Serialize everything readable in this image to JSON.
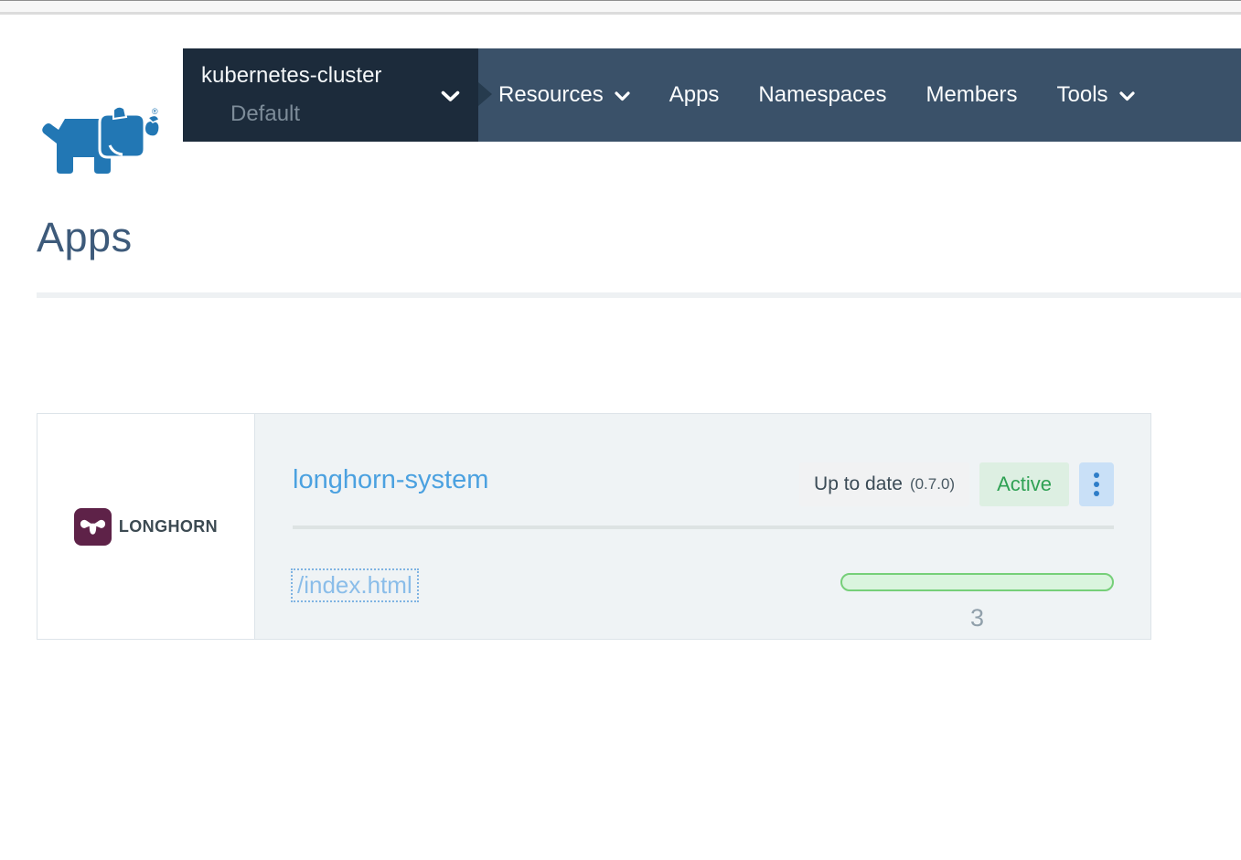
{
  "nav": {
    "logo": {
      "name": "Rancher",
      "registered_mark": "®"
    },
    "cluster": {
      "name": "kubernetes-cluster",
      "project": "Default"
    },
    "items": [
      {
        "label": "Resources",
        "dropdown": true
      },
      {
        "label": "Apps",
        "dropdown": false
      },
      {
        "label": "Namespaces",
        "dropdown": false
      },
      {
        "label": "Members",
        "dropdown": false
      },
      {
        "label": "Tools",
        "dropdown": true
      }
    ]
  },
  "page": {
    "title": "Apps"
  },
  "app_card": {
    "logo": {
      "text": "LONGHORN",
      "icon": "longhorn-bull-icon",
      "icon_color": "#5e2248"
    },
    "name": "longhorn-system",
    "upgrade_badge": {
      "label": "Up to date",
      "version": "(0.7.0)"
    },
    "status_badge": {
      "label": "Active"
    },
    "endpoint_link": "/index.html",
    "progress": {
      "value_pct": 100
    },
    "pod_count": "3"
  },
  "colors": {
    "nav_bg": "#3a5169",
    "cluster_box_bg": "#1c2b3b",
    "rancher_blue": "#2277b4",
    "link_blue": "#4ba1e0",
    "active_green": "#2fa154",
    "progress_green": "#76cf79",
    "card_bg": "#eff3f5"
  }
}
